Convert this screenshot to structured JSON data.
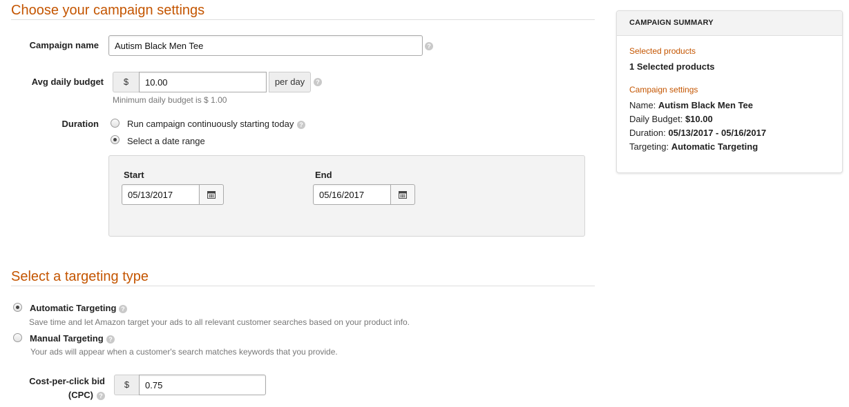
{
  "campaign_settings": {
    "title": "Choose your campaign settings",
    "name_label": "Campaign name",
    "name_value": "Autism Black Men Tee",
    "budget_label": "Avg daily budget",
    "currency": "$",
    "budget_value": "10.00",
    "per_day": "per day",
    "budget_hint": "Minimum daily budget is $ 1.00",
    "duration_label": "Duration",
    "duration_options": [
      {
        "label": "Run campaign continuously starting today",
        "selected": false
      },
      {
        "label": "Select a date range",
        "selected": true
      }
    ],
    "start_label": "Start",
    "start_value": "05/13/2017",
    "end_label": "End",
    "end_value": "05/16/2017",
    "calendar_icon": "calendar-icon",
    "help_icon": "help-icon"
  },
  "targeting": {
    "title": "Select a targeting type",
    "options": [
      {
        "label": "Automatic Targeting",
        "desc": "Save time and let Amazon target your ads to all relevant customer searches based on your product info.",
        "selected": true
      },
      {
        "label": "Manual Targeting",
        "desc": "Your ads will appear when a customer's search matches keywords that you provide.",
        "selected": false
      }
    ],
    "cpc_label_line1": "Cost-per-click bid",
    "cpc_label_line2": "(CPC)",
    "cpc_currency": "$",
    "cpc_value": "0.75"
  },
  "summary": {
    "header": "CAMPAIGN SUMMARY",
    "products_sub": "Selected products",
    "products_value": "1 Selected products",
    "settings_sub": "Campaign settings",
    "name_key": "Name:",
    "name_val": "Autism Black Men Tee",
    "budget_key": "Daily Budget:",
    "budget_val": "$10.00",
    "duration_key": "Duration:",
    "duration_val": "05/13/2017 - 05/16/2017",
    "targeting_key": "Targeting:",
    "targeting_val": "Automatic Targeting"
  },
  "colors": {
    "accent": "#c45500",
    "panel_bg": "#f3f3f3",
    "border": "#dddddd"
  }
}
